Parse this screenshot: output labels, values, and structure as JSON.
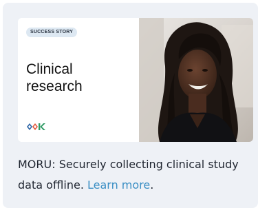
{
  "card": {
    "badge": "SUCCESS STORY",
    "title_line1": "Clinical",
    "title_line2": "research",
    "caption_text": "MORU: Securely collecting clinical study data offline.",
    "link_text": "Learn more",
    "caption_end": "."
  },
  "colors": {
    "card_bg": "#eef1f6",
    "link": "#3b8fc4",
    "badge_bg": "#dde8f2"
  }
}
